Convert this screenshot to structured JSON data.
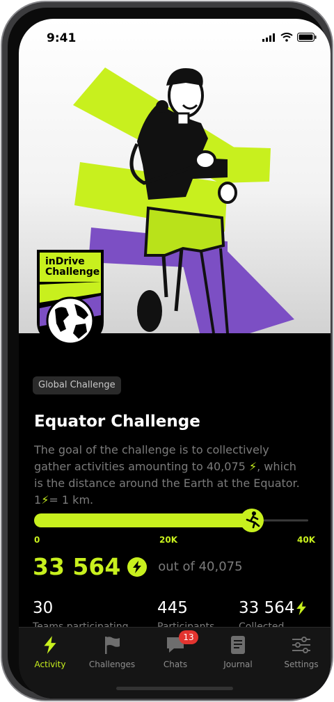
{
  "status_bar": {
    "time": "9:41"
  },
  "badge": {
    "line1": "inDrive",
    "line2": "Challenge"
  },
  "challenge": {
    "chip": "Global Challenge",
    "title": "Equator Challenge",
    "description_part1": "The goal of the challenge is to collectively gather activities amounting to 40,075",
    "description_part2": ", which is the distance around the Earth at the Equator.",
    "description_part3_prefix": "1",
    "description_part3_suffix": "= 1 km.",
    "progress_fraction": 0.8375,
    "ticks": [
      "0",
      "20K",
      "40K"
    ],
    "total": "33 564",
    "out_of": "out of 40,075"
  },
  "stats": [
    {
      "value": "30",
      "label": "Teams participating"
    },
    {
      "value": "445",
      "label": "Participants"
    },
    {
      "value": "33 564",
      "label": "Collected"
    }
  ],
  "tabs": [
    {
      "label": "Activity",
      "icon": "bolt-icon"
    },
    {
      "label": "Challenges",
      "icon": "flag-icon"
    },
    {
      "label": "Chats",
      "icon": "chat-icon",
      "badge": "13"
    },
    {
      "label": "Journal",
      "icon": "journal-icon"
    },
    {
      "label": "Settings",
      "icon": "sliders-icon"
    }
  ],
  "colors": {
    "accent": "#c8f01e",
    "purple": "#7c4fc4",
    "background": "#000000",
    "notification": "#e3342f"
  }
}
